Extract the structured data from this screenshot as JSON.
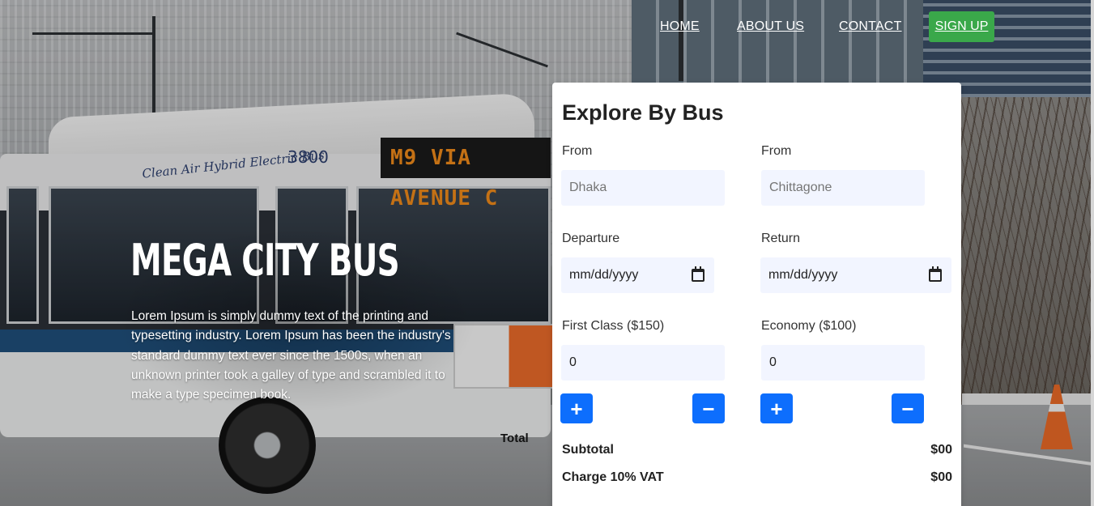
{
  "nav": {
    "home": "HOME",
    "about": "ABOUT US",
    "contact": "CONTACT",
    "signup": "SIGN UP",
    "signup_color": "#3aa84a"
  },
  "hero": {
    "title": "MEGA CITY BUS",
    "description": "Lorem Ipsum is simply dummy text of the printing and typesetting industry. Lorem Ipsum has been the industry's standard dummy text ever since the 1500s, when an unknown printer took a galley of type and scrambled it to make a type specimen book.",
    "total_label": "Total"
  },
  "background": {
    "bus_sign": "M9  VIA AVENUE C",
    "bus_side_text": "Clean Air Hybrid Electric Bus",
    "bus_number": "3800"
  },
  "booking": {
    "title": "Explore By Bus",
    "from_label": "From",
    "from_placeholder": "Dhaka",
    "to_label": "From",
    "to_placeholder": "Chittagone",
    "departure_label": "Departure",
    "departure_value": "mm/dd/yyyy",
    "return_label": "Return",
    "return_value": "mm/dd/yyyy",
    "first_class_label": "First Class ($150)",
    "first_class_qty": "0",
    "economy_label": "Economy ($100)",
    "economy_qty": "0",
    "plus_symbol": "+",
    "minus_symbol": "−",
    "button_color": "#0d6efd",
    "subtotal_label": "Subtotal",
    "subtotal_value": "$00",
    "vat_label": "Charge 10% VAT",
    "vat_value": "$00"
  }
}
